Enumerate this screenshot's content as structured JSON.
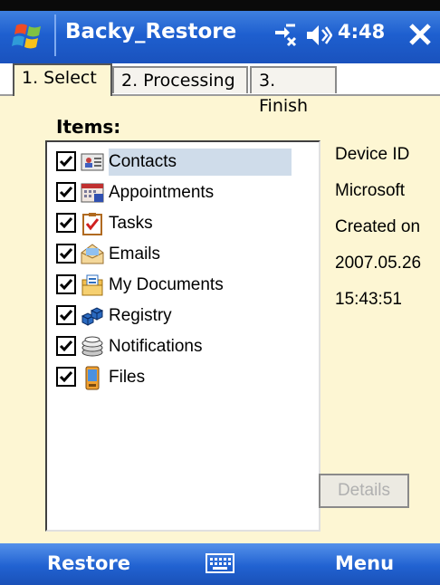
{
  "titlebar": {
    "title": "Backy_Restore",
    "time": "4:48",
    "icons": [
      "windows-start-icon",
      "connectivity-icon",
      "volume-icon",
      "close-icon"
    ]
  },
  "tabs": [
    {
      "label": "1. Select",
      "active": true
    },
    {
      "label": "2. Processing",
      "active": false
    },
    {
      "label": "3. Finish",
      "active": false
    }
  ],
  "items": {
    "heading": "Items:",
    "list": [
      {
        "label": "Contacts",
        "checked": true,
        "selected": true,
        "icon": "contacts-icon"
      },
      {
        "label": "Appointments",
        "checked": true,
        "selected": false,
        "icon": "calendar-icon"
      },
      {
        "label": "Tasks",
        "checked": true,
        "selected": false,
        "icon": "tasks-icon"
      },
      {
        "label": "Emails",
        "checked": true,
        "selected": false,
        "icon": "email-icon"
      },
      {
        "label": "My Documents",
        "checked": true,
        "selected": false,
        "icon": "documents-icon"
      },
      {
        "label": "Registry",
        "checked": true,
        "selected": false,
        "icon": "registry-icon"
      },
      {
        "label": "Notifications",
        "checked": true,
        "selected": false,
        "icon": "notifications-icon"
      },
      {
        "label": "Files",
        "checked": true,
        "selected": false,
        "icon": "files-icon"
      }
    ]
  },
  "info": {
    "device_id_label": "Device ID",
    "device_id": "Microsoft",
    "created_label": "Created on",
    "created_date": "2007.05.26",
    "created_time": "15:43:51"
  },
  "details_button": "Details",
  "softbar": {
    "left": "Restore",
    "right": "Menu",
    "center_icon": "keyboard-icon"
  }
}
